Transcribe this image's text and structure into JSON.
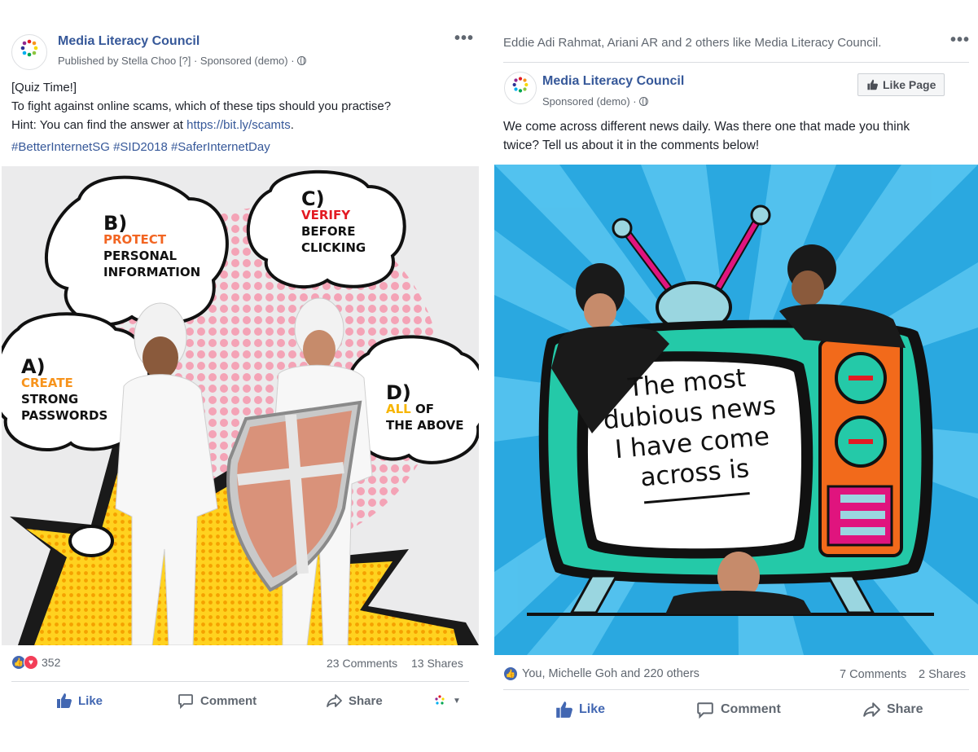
{
  "post1": {
    "page_name": "Media Literacy Council",
    "published_by": "Published by Stella Choo",
    "published_suffix": "[?]",
    "sponsored": "· Sponsored (demo) ·",
    "text_line1": "[Quiz Time!]",
    "text_line2": "To fight against online scams, which of these tips should you practise?",
    "text_line3_prefix": "Hint: You can find the answer at ",
    "text_link": "https://bit.ly/scamts",
    "text_line3_suffix": ".",
    "hashtags": "#BetterInternetSG #SID2018 #SaferInternetDay",
    "quiz": {
      "a_letter": "A)",
      "a_keyword": "CREATE",
      "a_rest1": "STRONG",
      "a_rest2": "PASSWORDS",
      "b_letter": "B)",
      "b_keyword": "PROTECT",
      "b_rest1": "PERSONAL",
      "b_rest2": "INFORMATION",
      "c_letter": "C)",
      "c_keyword": "VERIFY",
      "c_rest1": "BEFORE",
      "c_rest2": "CLICKING",
      "d_letter": "D)",
      "d_keyword": "ALL",
      "d_rest1": "OF",
      "d_rest2": "THE ABOVE"
    },
    "reaction_count": "352",
    "comments": "23 Comments",
    "shares": "13 Shares",
    "actions": {
      "like": "Like",
      "comment": "Comment",
      "share": "Share"
    }
  },
  "post2": {
    "social_context": "Eddie Adi Rahmat, Ariani AR and 2 others like Media Literacy Council.",
    "page_name": "Media Literacy Council",
    "sponsored": "Sponsored (demo) ·",
    "like_page": "Like Page",
    "text_line1": "We come across different news daily. Was there one that made you think",
    "text_line2": "twice? Tell us about it in the comments below!",
    "tv_line1": "The most",
    "tv_line2": "dubious news",
    "tv_line3": "I have come",
    "tv_line4": "across is",
    "reactions": "You, Michelle Goh and 220 others",
    "comments": "7 Comments",
    "shares": "2 Shares",
    "actions": {
      "like": "Like",
      "comment": "Comment",
      "share": "Share"
    }
  },
  "colors": {
    "brand_blue": "#365899",
    "action_blue": "#4267b2",
    "meta_gray": "#606770",
    "quiz_orange": "#f26522",
    "quiz_red": "#e31b23",
    "quiz_yellow": "#f7b500",
    "tv_sky": "#2aa8e0",
    "tv_teal": "#24c9a8",
    "tv_magenta": "#e0147e"
  },
  "icons": [
    "logo-icon",
    "globe-icon",
    "more-icon",
    "like-icon",
    "love-icon",
    "comment-icon",
    "share-icon",
    "chevron-down-icon",
    "thumbs-up-icon"
  ]
}
